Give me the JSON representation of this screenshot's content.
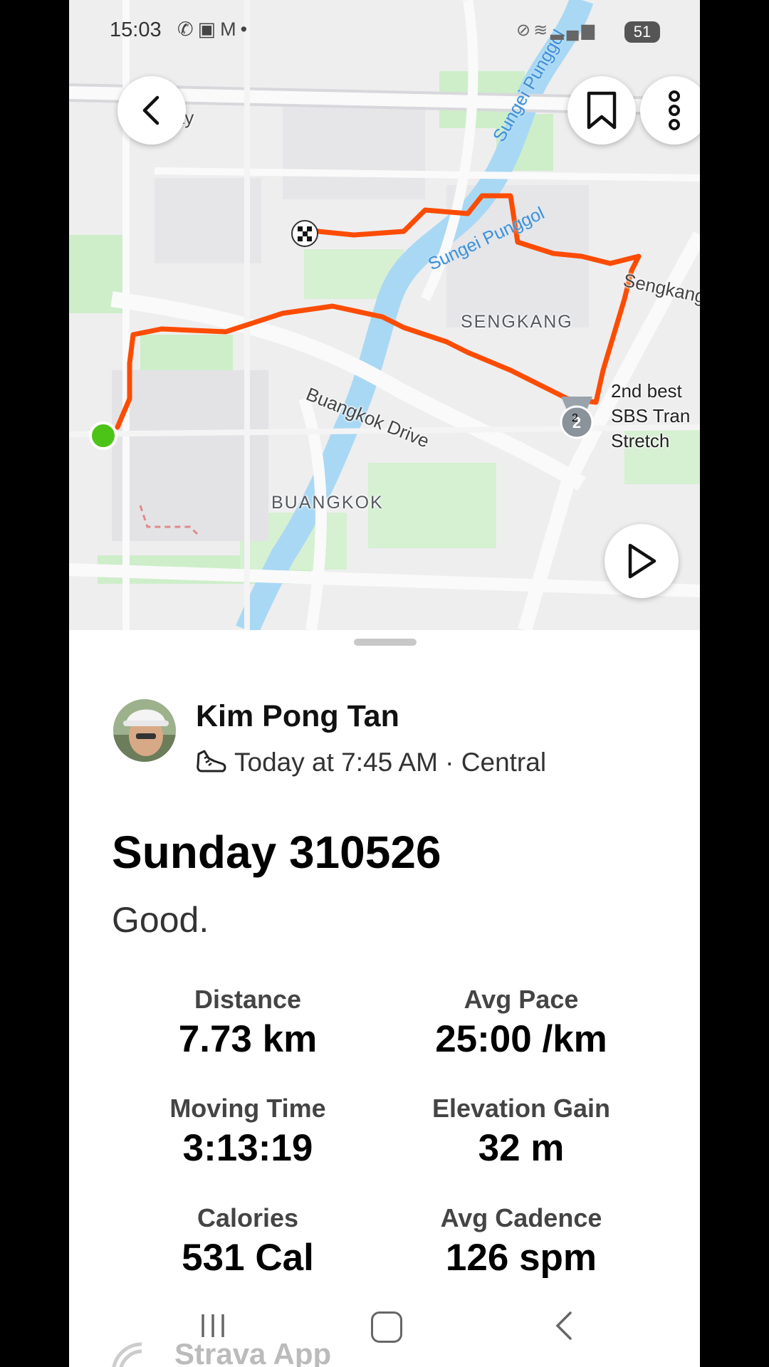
{
  "status_bar": {
    "time": "15:03",
    "left_icons": [
      "whatsapp-icon",
      "video-icon",
      "gmail-icon",
      "dot"
    ],
    "battery": "51"
  },
  "map": {
    "area_labels": [
      "SENGKANG",
      "BUANGKOK"
    ],
    "road_labels": [
      "Buangkok Drive",
      "Sengkang",
      "sway"
    ],
    "water_labels": [
      "Sungei Punggol"
    ],
    "segment_achievement": {
      "rank": "2",
      "label": "2nd best\nSBS Tran\nStretch"
    },
    "colors": {
      "route": "#fc4c02",
      "start": "#4cc417",
      "water": "#a9d8f4",
      "park": "#b8e3b3"
    }
  },
  "activity": {
    "athlete_name": "Kim Pong Tan",
    "meta": "Today at 7:45 AM · Central",
    "activity_type_icon": "shoe-icon",
    "title": "Sunday 310526",
    "description": "Good.",
    "stats": [
      {
        "label": "Distance",
        "value": "7.73 km"
      },
      {
        "label": "Avg Pace",
        "value": "25:00 /km"
      },
      {
        "label": "Moving Time",
        "value": "3:13:19"
      },
      {
        "label": "Elevation Gain",
        "value": "32 m"
      },
      {
        "label": "Calories",
        "value": "531 Cal"
      },
      {
        "label": "Avg Cadence",
        "value": "126 spm"
      }
    ]
  },
  "peek": {
    "text": "Strava App"
  }
}
